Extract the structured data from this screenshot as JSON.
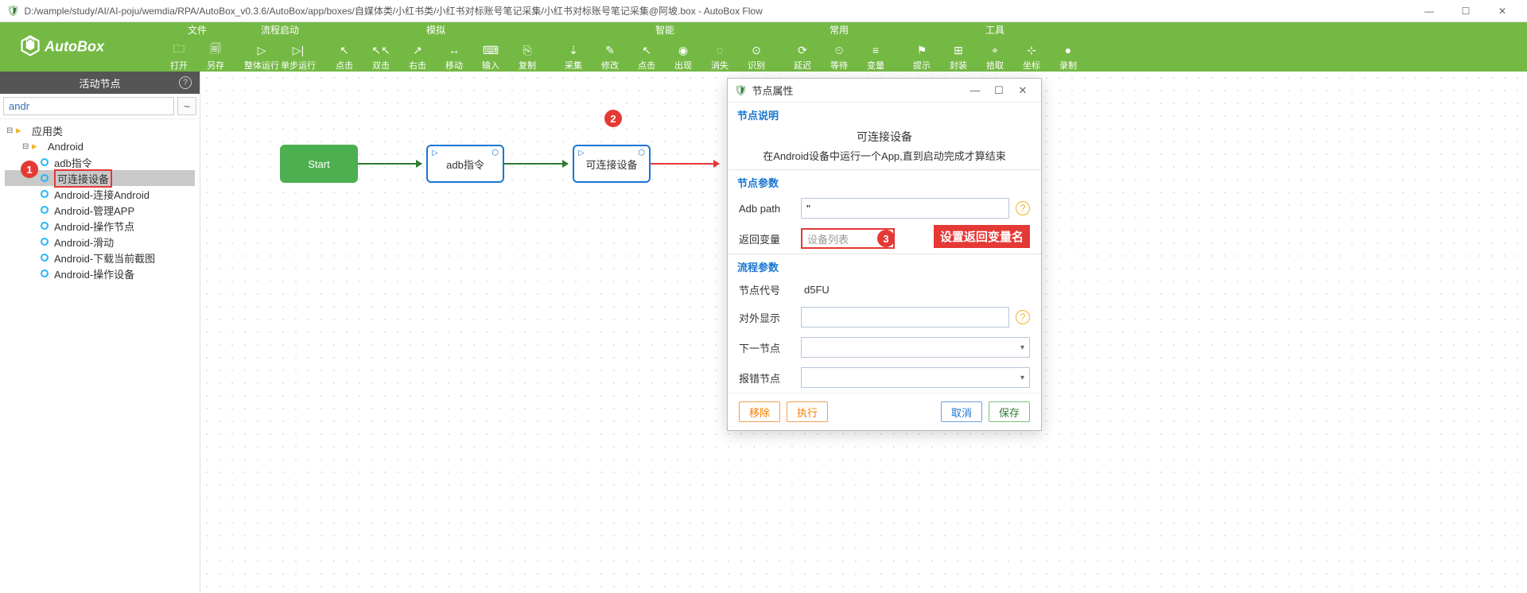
{
  "window": {
    "title": "D:/wample/study/AI/AI-poju/wemdia/RPA/AutoBox_v0.3.6/AutoBox/app/boxes/自媒体类/小红书类/小红书对标账号笔记采集/小红书对标账号笔记采集@阿坡.box - AutoBox Flow"
  },
  "logo_text": "AutoBox",
  "toolbar": {
    "groups": [
      {
        "label": "文件",
        "items": [
          {
            "label": "打开",
            "icon": "🗀"
          },
          {
            "label": "另存",
            "icon": "🗐"
          }
        ]
      },
      {
        "label": "流程启动",
        "items": [
          {
            "label": "整体运行",
            "icon": "▷"
          },
          {
            "label": "单步运行",
            "icon": "▷|"
          }
        ]
      },
      {
        "label": "模拟",
        "items": [
          {
            "label": "点击",
            "icon": "↖"
          },
          {
            "label": "双击",
            "icon": "↖↖"
          },
          {
            "label": "右击",
            "icon": "↗"
          },
          {
            "label": "移动",
            "icon": "↔"
          },
          {
            "label": "输入",
            "icon": "⌨"
          },
          {
            "label": "复制",
            "icon": "⎘"
          }
        ]
      },
      {
        "label": "智能",
        "items": [
          {
            "label": "采集",
            "icon": "⇣"
          },
          {
            "label": "修改",
            "icon": "✎"
          },
          {
            "label": "点击",
            "icon": "↖"
          },
          {
            "label": "出现",
            "icon": "◉"
          },
          {
            "label": "消失",
            "icon": "◌"
          },
          {
            "label": "识别",
            "icon": "⊙"
          }
        ]
      },
      {
        "label": "常用",
        "items": [
          {
            "label": "延迟",
            "icon": "⟳"
          },
          {
            "label": "等待",
            "icon": "⏲"
          },
          {
            "label": "变量",
            "icon": "≡"
          }
        ]
      },
      {
        "label": "工具",
        "items": [
          {
            "label": "提示",
            "icon": "⚑"
          },
          {
            "label": "封装",
            "icon": "⊞"
          },
          {
            "label": "拾取",
            "icon": "⌖"
          },
          {
            "label": "坐标",
            "icon": "⊹"
          },
          {
            "label": "录制",
            "icon": "●"
          }
        ]
      }
    ]
  },
  "sidebar": {
    "header": "活动节点",
    "search_value": "andr",
    "tilde": "~",
    "tree": {
      "root_label": "应用类",
      "android_label": "Android",
      "adb_label": "adb指令",
      "connectable": "可连接设备",
      "items": [
        "Android-连接Android",
        "Android-管理APP",
        "Android-操作节点",
        "Android-滑动",
        "Android-下载当前截图",
        "Android-操作设备"
      ]
    }
  },
  "canvas": {
    "start": "Start",
    "node1": "adb指令",
    "node2": "可连接设备"
  },
  "callouts": {
    "one": "1",
    "two": "2",
    "three": "3",
    "label3": "设置返回变量名"
  },
  "panel": {
    "title": "节点属性",
    "section_desc_h": "节点说明",
    "desc_title": "可连接设备",
    "desc_sub": "在Android设备中运行一个App,直到启动完成才算结束",
    "section_param_h": "节点参数",
    "adb_path_label": "Adb path",
    "adb_path_value": "''",
    "return_var_label": "返回变量",
    "return_var_placeholder": "设备列表",
    "section_flow_h": "流程参数",
    "node_code_label": "节点代号",
    "node_code_value": "d5FU",
    "display_label": "对外显示",
    "next_label": "下一节点",
    "error_label": "报错节点",
    "btn_remove": "移除",
    "btn_exec": "执行",
    "btn_cancel": "取消",
    "btn_save": "保存"
  }
}
